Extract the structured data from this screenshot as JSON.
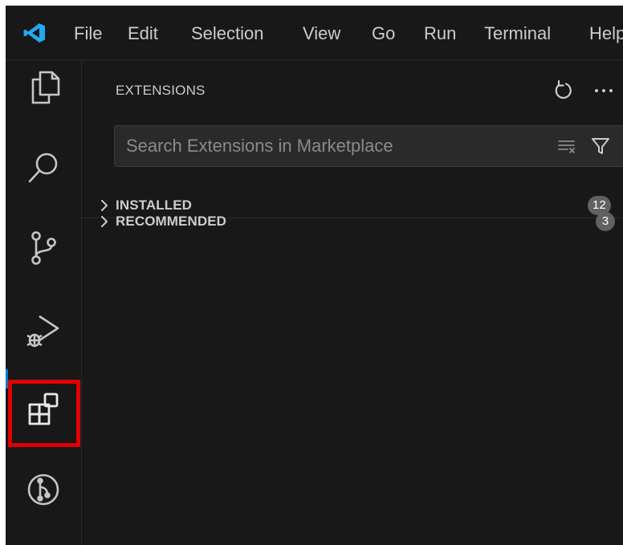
{
  "menu": {
    "items": [
      "File",
      "Edit",
      "Selection",
      "View",
      "Go",
      "Run",
      "Terminal",
      "Help"
    ]
  },
  "activity_bar": {
    "items": [
      {
        "icon": "explorer-icon"
      },
      {
        "icon": "search-icon"
      },
      {
        "icon": "source-control-icon"
      },
      {
        "icon": "run-and-debug-icon"
      },
      {
        "icon": "extensions-icon",
        "active": true,
        "highlighted": true
      },
      {
        "icon": "git-graph-icon"
      }
    ]
  },
  "sidebar": {
    "title": "EXTENSIONS",
    "search": {
      "placeholder": "Search Extensions in Marketplace",
      "value": ""
    },
    "sections": [
      {
        "label": "INSTALLED",
        "count": "12"
      },
      {
        "label": "RECOMMENDED",
        "count": "3"
      }
    ]
  },
  "colors": {
    "background": "#181818",
    "text": "#cccccc",
    "badge": "#616161",
    "logo_blue": "#23a9f2",
    "active_indicator": "#0078d4",
    "highlight_box": "#e00000"
  }
}
